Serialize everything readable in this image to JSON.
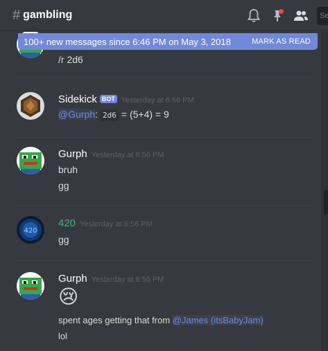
{
  "header": {
    "hash": "#",
    "channel": "gambling",
    "search_placeholder": "Se"
  },
  "new_messages_bar": {
    "text": "100+ new messages since 6:46 PM on May 3, 2018",
    "action": "MARK AS READ"
  },
  "messages": [
    {
      "lines": [
        "/r 2d6"
      ]
    },
    {
      "username": "Sidekick",
      "bot_tag": "BOT",
      "timestamp": "Yesterday at 6:56 PM",
      "mention": "@Gurph",
      "colon": ":",
      "code": "2d6",
      "result": "= (5+4) = 9"
    },
    {
      "username": "Gurph",
      "timestamp": "Yesterday at 6:56 PM",
      "lines": [
        "bruh",
        "gg"
      ]
    },
    {
      "username": "420",
      "username_color": "#43b581",
      "timestamp": "Yesterday at 6:56 PM",
      "lines": [
        "gg"
      ]
    },
    {
      "username": "Gurph",
      "timestamp": "Yesterday at 6:56 PM",
      "emoji": "😢",
      "text_before_mention": "spent ages getting that from ",
      "mention": "@James (itsBabyJam)",
      "lines": [
        "lol"
      ]
    }
  ],
  "colors": {
    "background": "#36393f",
    "accent": "#7289da",
    "notification": "#f04747"
  }
}
